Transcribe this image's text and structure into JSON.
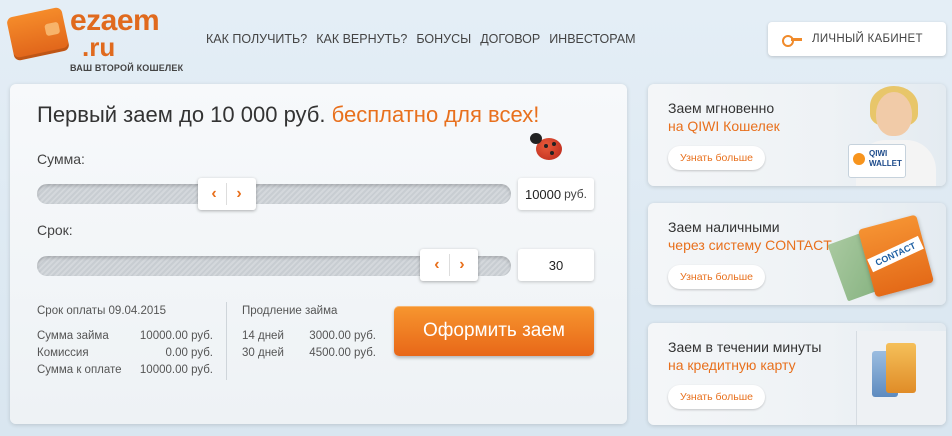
{
  "header": {
    "logo_line1": "ezaem",
    "logo_line2": ".ru",
    "tagline": "ВАШ ВТОРОЙ КОШЕЛЕК",
    "nav": [
      "КАК ПОЛУЧИТЬ?",
      "КАК ВЕРНУТЬ?",
      "БОНУСЫ",
      "ДОГОВОР",
      "ИНВЕСТОРАМ"
    ],
    "cabinet_label": "ЛИЧНЫЙ КАБИНЕТ",
    "cabinet_icon": "key-icon"
  },
  "main": {
    "headline_main": "Первый заем до 10 000 руб.",
    "headline_accent": "бесплатно для всех!",
    "amount_label": "Сумма:",
    "amount_value": "10000",
    "amount_unit": "руб.",
    "term_label": "Срок:",
    "term_value": "30",
    "amount_slider_fraction": 0.4,
    "term_slider_fraction": 0.87,
    "due_date_text": "Срок оплаты 09.04.2015",
    "summary": [
      {
        "label": "Сумма займа",
        "value": "10000.00 руб."
      },
      {
        "label": "Комиссия",
        "value": "0.00 руб."
      },
      {
        "label": "Сумма к оплате",
        "value": "10000.00 руб."
      }
    ],
    "extension_title": "Продление займа",
    "extension": [
      {
        "label": "14 дней",
        "value": "3000.00 руб."
      },
      {
        "label": "30 дней",
        "value": "4500.00 руб."
      }
    ],
    "apply_label": "Оформить заем"
  },
  "promos": [
    {
      "line1": "Заем мгновенно",
      "line2": "на QIWI  Кошелек",
      "button": "Узнать больше",
      "card_text": "QIWI WALLET"
    },
    {
      "line1": "Заем наличными",
      "line2": "через систему CONTACT",
      "button": "Узнать больше",
      "card_text": "CONTACT"
    },
    {
      "line1": "Заем в течении минуты",
      "line2": "на кредитную карту",
      "button": "Узнать больше"
    }
  ],
  "colors": {
    "accent": "#e8701d",
    "text": "#333333"
  }
}
